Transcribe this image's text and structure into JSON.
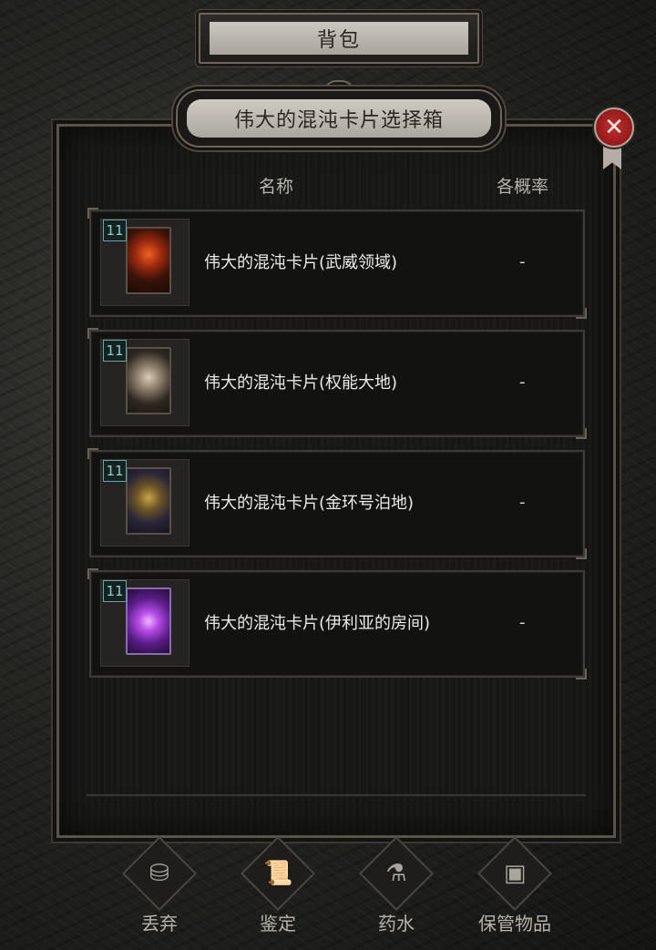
{
  "top_tab": {
    "label": "背包"
  },
  "dialog": {
    "title": "伟大的混沌卡片选择箱",
    "close_icon": "close-icon",
    "columns": {
      "name": "名称",
      "probability": "各概率"
    },
    "items": [
      {
        "level": "11",
        "name": "伟大的混沌卡片(武威领域)",
        "probability": "-"
      },
      {
        "level": "11",
        "name": "伟大的混沌卡片(权能大地)",
        "probability": "-"
      },
      {
        "level": "11",
        "name": "伟大的混沌卡片(金环号泊地)",
        "probability": "-"
      },
      {
        "level": "11",
        "name": "伟大的混沌卡片(伊利亚的房间)",
        "probability": "-"
      }
    ]
  },
  "toolbar": [
    {
      "label": "丢弃",
      "icon": "barrel-icon"
    },
    {
      "label": "鉴定",
      "icon": "scroll-icon"
    },
    {
      "label": "药水",
      "icon": "potion-icon"
    },
    {
      "label": "保管物品",
      "icon": "chest-icon"
    }
  ]
}
